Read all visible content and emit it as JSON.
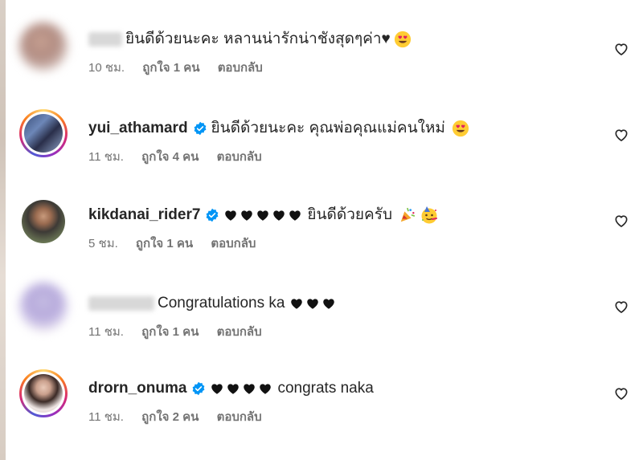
{
  "comments": [
    {
      "username": "",
      "verified": false,
      "text": "ยินดีด้วยนะคะ หลานน่ารักน่าชังสุดๆค่า♥",
      "emoji": "heart-eyes",
      "time": "10 ชม.",
      "likes": "ถูกใจ 1 คน",
      "reply": "ตอบกลับ"
    },
    {
      "username": "yui_athamard",
      "verified": true,
      "text": "ยินดีด้วยนะคะ คุณพ่อคุณแม่คนใหม่",
      "emoji": "heart-eyes",
      "time": "11 ชม.",
      "likes": "ถูกใจ 4 คน",
      "reply": "ตอบกลับ"
    },
    {
      "username": "kikdanai_rider7",
      "verified": true,
      "hearts": 5,
      "text": "ยินดีด้วยครับ",
      "emoji": "party",
      "time": "5 ชม.",
      "likes": "ถูกใจ 1 คน",
      "reply": "ตอบกลับ"
    },
    {
      "username": "",
      "verified": false,
      "text": "Congratulations ka",
      "hearts_after": 3,
      "time": "11 ชม.",
      "likes": "ถูกใจ 1 คน",
      "reply": "ตอบกลับ"
    },
    {
      "username": "drorn_onuma",
      "verified": true,
      "hearts": 4,
      "text": "congrats naka",
      "time": "11 ชม.",
      "likes": "ถูกใจ 2 คน",
      "reply": "ตอบกลับ"
    }
  ],
  "colors": {
    "verified": "#0095f6",
    "meta": "#737373",
    "text": "#262626"
  }
}
